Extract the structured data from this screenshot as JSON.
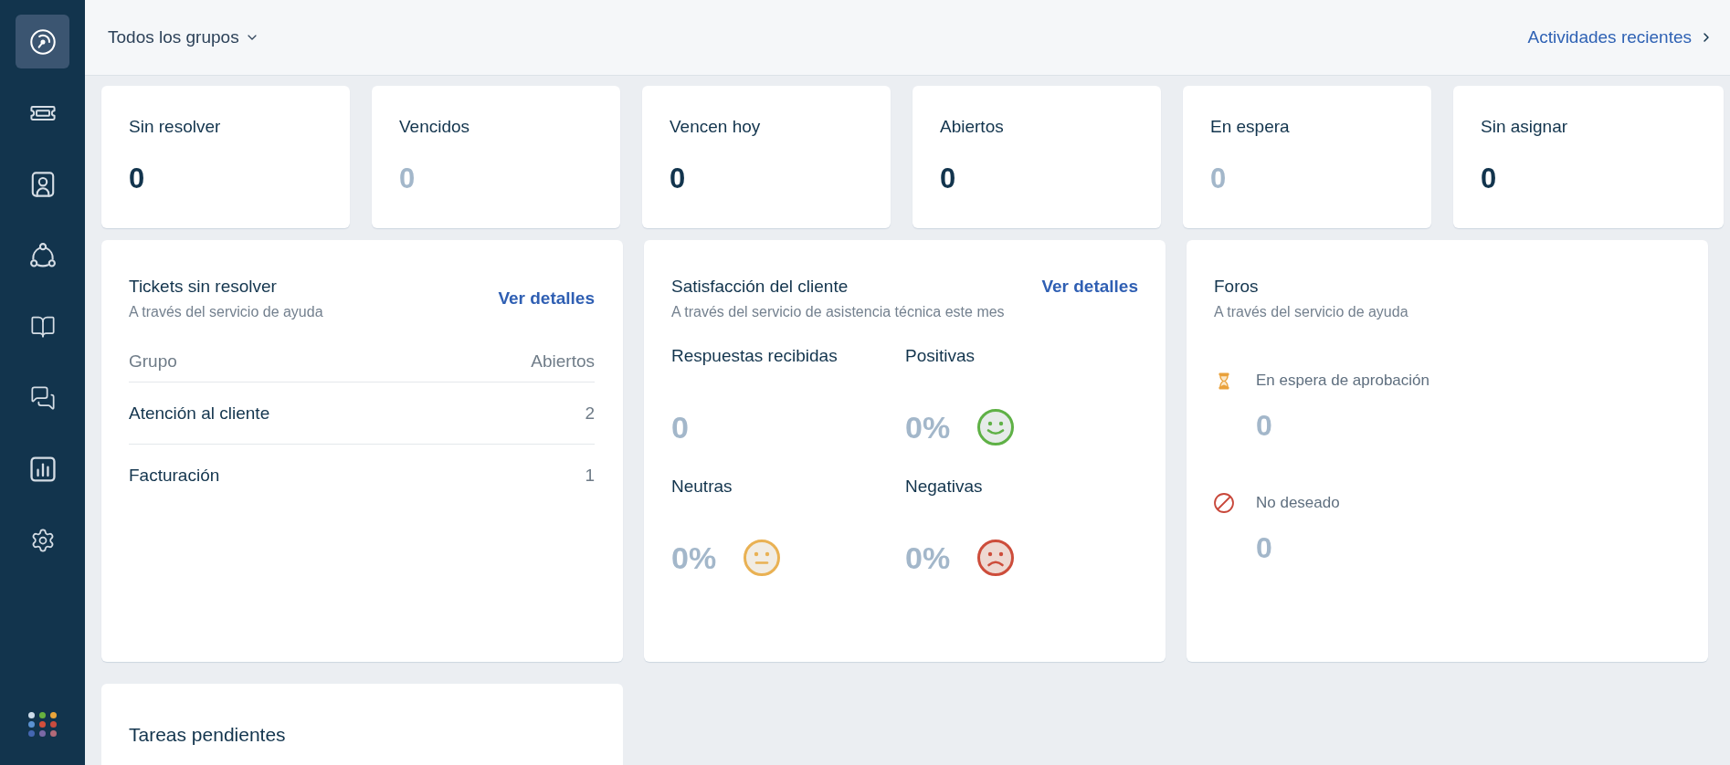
{
  "sidebar": {
    "items": [
      {
        "selected": true
      },
      {
        "selected": false
      },
      {
        "selected": false
      },
      {
        "selected": false
      },
      {
        "selected": false
      },
      {
        "selected": false
      },
      {
        "selected": false
      },
      {
        "selected": false
      }
    ]
  },
  "header": {
    "group_filter": "Todos los grupos",
    "recent_activity_link": "Actividades recientes"
  },
  "stats": [
    {
      "label": "Sin resolver",
      "value": "0",
      "muted": false
    },
    {
      "label": "Vencidos",
      "value": "0",
      "muted": true
    },
    {
      "label": "Vencen hoy",
      "value": "0",
      "muted": false
    },
    {
      "label": "Abiertos",
      "value": "0",
      "muted": false
    },
    {
      "label": "En espera",
      "value": "0",
      "muted": true
    },
    {
      "label": "Sin asignar",
      "value": "0",
      "muted": false
    }
  ],
  "unresolved_tickets": {
    "title": "Tickets sin resolver",
    "subtitle": "A través del servicio de ayuda",
    "link": "Ver detalles",
    "columns": [
      "Grupo",
      "Abiertos"
    ],
    "rows": [
      {
        "group": "Atención al cliente",
        "open": "2"
      },
      {
        "group": "Facturación",
        "open": "1"
      }
    ]
  },
  "customer_satisfaction": {
    "title": "Satisfacción del cliente",
    "subtitle": "A través del servicio de asistencia técnica este mes",
    "link": "Ver detalles",
    "metrics": [
      {
        "kind": "count",
        "label": "Respuestas recibidas",
        "value": "0"
      },
      {
        "kind": "positive",
        "label": "Positivas",
        "value": "0%"
      },
      {
        "kind": "neutral",
        "label": "Neutras",
        "value": "0%"
      },
      {
        "kind": "negative",
        "label": "Negativas",
        "value": "0%"
      }
    ]
  },
  "forums": {
    "title": "Foros",
    "subtitle": "A través del servicio de ayuda",
    "items": [
      {
        "kind": "pending",
        "label": "En espera de aprobación",
        "value": "0"
      },
      {
        "kind": "unwanted",
        "label": "No deseado",
        "value": "0"
      }
    ]
  },
  "pending_tasks": {
    "title": "Tareas pendientes"
  }
}
